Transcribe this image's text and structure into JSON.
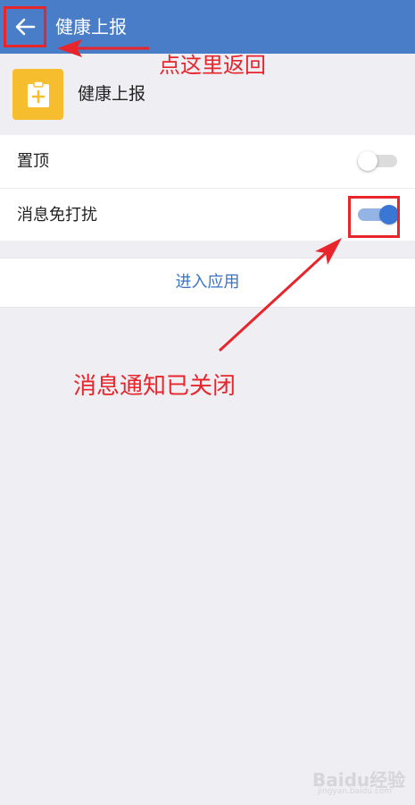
{
  "topbar": {
    "title": "健康上报",
    "back_icon": "arrow-left-icon"
  },
  "app": {
    "name": "健康上报",
    "icon": "clipboard-plus-icon",
    "icon_color": "#f6bd2f"
  },
  "settings": [
    {
      "label": "置顶",
      "toggle_on": false
    },
    {
      "label": "消息免打扰",
      "toggle_on": true
    }
  ],
  "enter_app": {
    "label": "进入应用"
  },
  "annotations": {
    "back_hint": "点这里返回",
    "mute_hint": "消息通知已关闭"
  },
  "watermark": {
    "text": "Baidu经验",
    "sub": "jingyan.baidu.com"
  },
  "colors": {
    "header": "#4a7dc7",
    "accent": "#3a77d4",
    "annotation": "#e8252b",
    "link": "#3b73c4"
  }
}
